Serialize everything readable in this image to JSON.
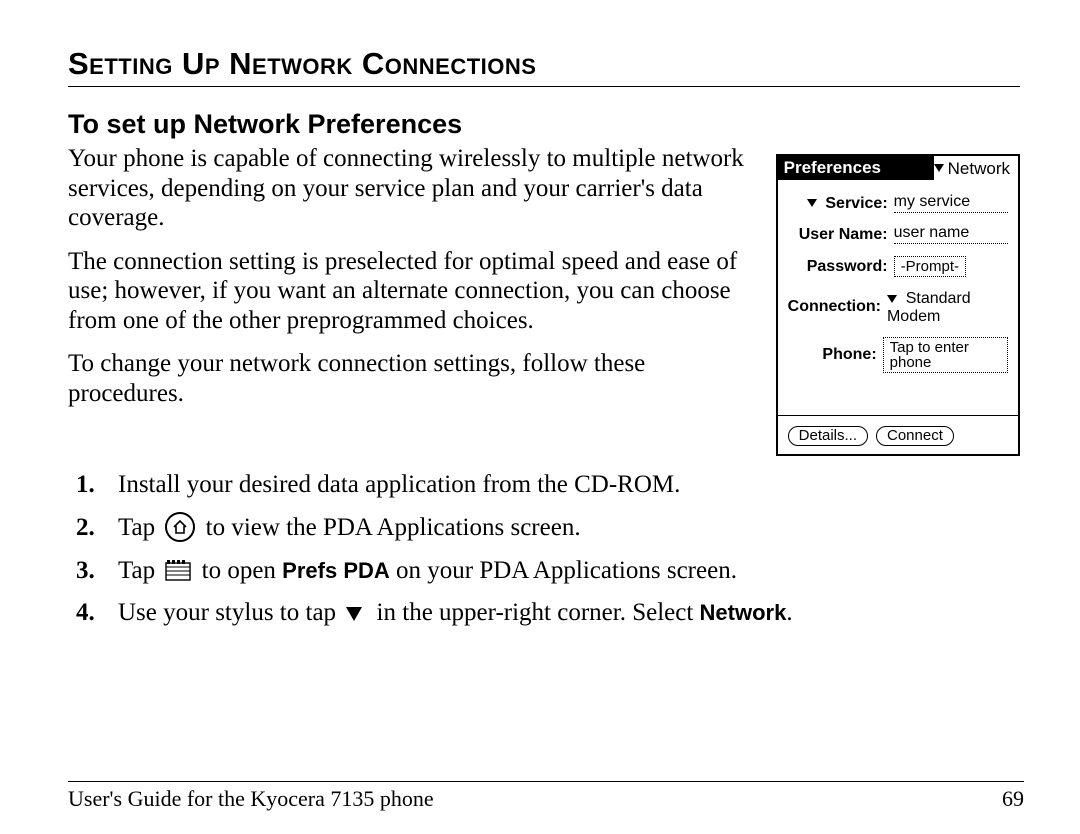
{
  "title": "Setting Up Network Connections",
  "section_heading": "To set up Network Preferences",
  "paragraphs": {
    "p1": "Your phone is capable of connecting wirelessly to multiple network services, depending on your service plan and your carrier's data coverage.",
    "p2": "The connection setting is preselected for optimal speed and ease of use; however, if you want an alternate connection, you can choose from one of the other preprogrammed choices.",
    "p3": "To change your network connection settings, follow these procedures."
  },
  "steps": {
    "s1": "Install your desired data application from the CD-ROM.",
    "s2a": "Tap",
    "s2b": "to view the PDA Applications screen.",
    "s3a": "Tap",
    "s3b": "to open",
    "s3c": "Prefs PDA",
    "s3d": "on your PDA Applications screen.",
    "s4a": "Use your stylus to tap",
    "s4b": "in the upper-right corner. Select",
    "s4c": "Network",
    "s4d": "."
  },
  "pda": {
    "header_title": "Preferences",
    "header_menu": "Network",
    "labels": {
      "service": "Service:",
      "username": "User Name:",
      "password": "Password:",
      "connection": "Connection:",
      "phone": "Phone:"
    },
    "values": {
      "service": "my service",
      "username": "user name",
      "password": "-Prompt-",
      "connection": "Standard Modem",
      "phone": "Tap to enter phone"
    },
    "buttons": {
      "details": "Details...",
      "connect": "Connect"
    }
  },
  "footer": {
    "left": "User's Guide for the Kyocera 7135 phone",
    "page": "69"
  }
}
